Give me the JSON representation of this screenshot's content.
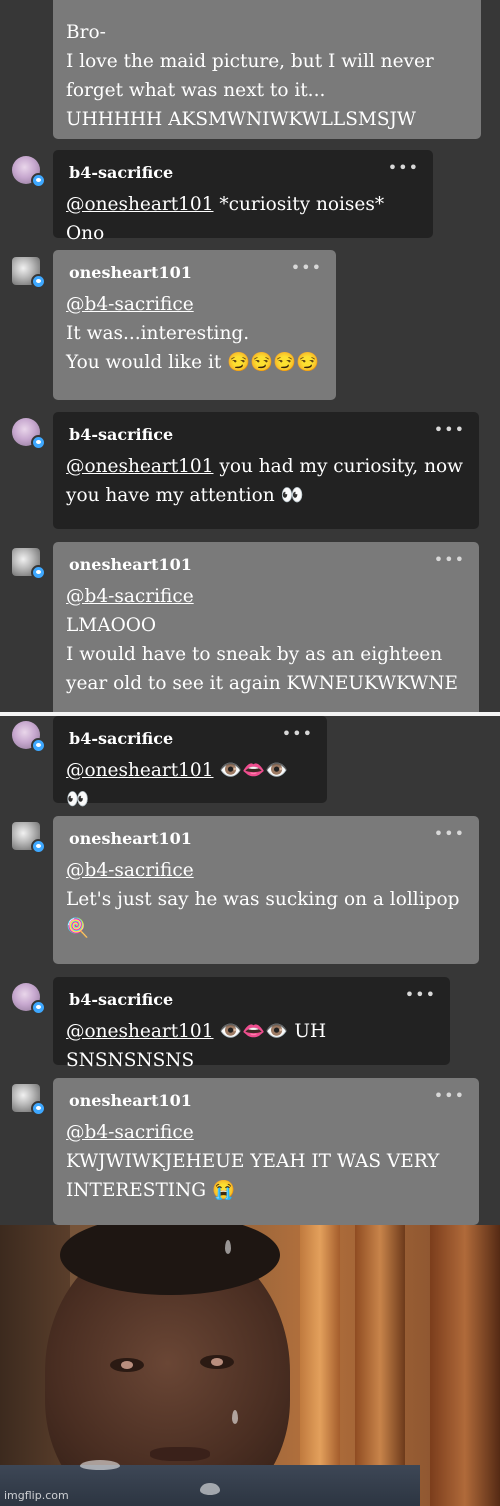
{
  "colors": {
    "background": "#373737",
    "bubble_dark": "#222222",
    "bubble_light": "#7a7a7a",
    "badge": "#3ea8ff"
  },
  "top_panel": {
    "first_message": {
      "lines": "Bro-\nI love the maid picture, but I will never forget what was next to it...\nUHHHHH AKSMWNIWKWLLSMSJW"
    },
    "messages": [
      {
        "user": "b4-sacrifice",
        "mention": "@oneshe art101",
        "text": " *curiosity noises* Ono"
      },
      {
        "user": "onesheart101",
        "mention": "@b4-sacrifice",
        "text": "It was...interesting.\nYou would like it 😏😏😏😏"
      },
      {
        "user": "b4-sacrifice",
        "mention": "@onesheart101",
        "text": " you had my curiosity, now you have my attention 👀"
      },
      {
        "user": "onesheart101",
        "mention": "@b4-sacrifice",
        "text": "LMAOOO\nI would have to sneak by as an eighteen year old to see it again KWNEUKWKWNE"
      }
    ]
  },
  "bottom_panel": {
    "messages": [
      {
        "user": "b4-sacrifice",
        "mention": "@onesheart101",
        "text": " 👁️👄👁️ 👀"
      },
      {
        "user": "onesheart101",
        "mention": "@b4-sacrifice",
        "text": "Let's just say he was sucking on a lollipop\n🍭"
      },
      {
        "user": "b4-sacrifice",
        "mention": "@onesheart101",
        "text": " 👁️👄👁️ UH SNSNSNSNS"
      },
      {
        "user": "onesheart101",
        "mention": "@b4-sacrifice",
        "text": "KWJWIWKJEHEUE YEAH IT WAS VERY INTERESTING 😭"
      }
    ]
  },
  "more_options": "•••",
  "watermark": "imgflip.com"
}
